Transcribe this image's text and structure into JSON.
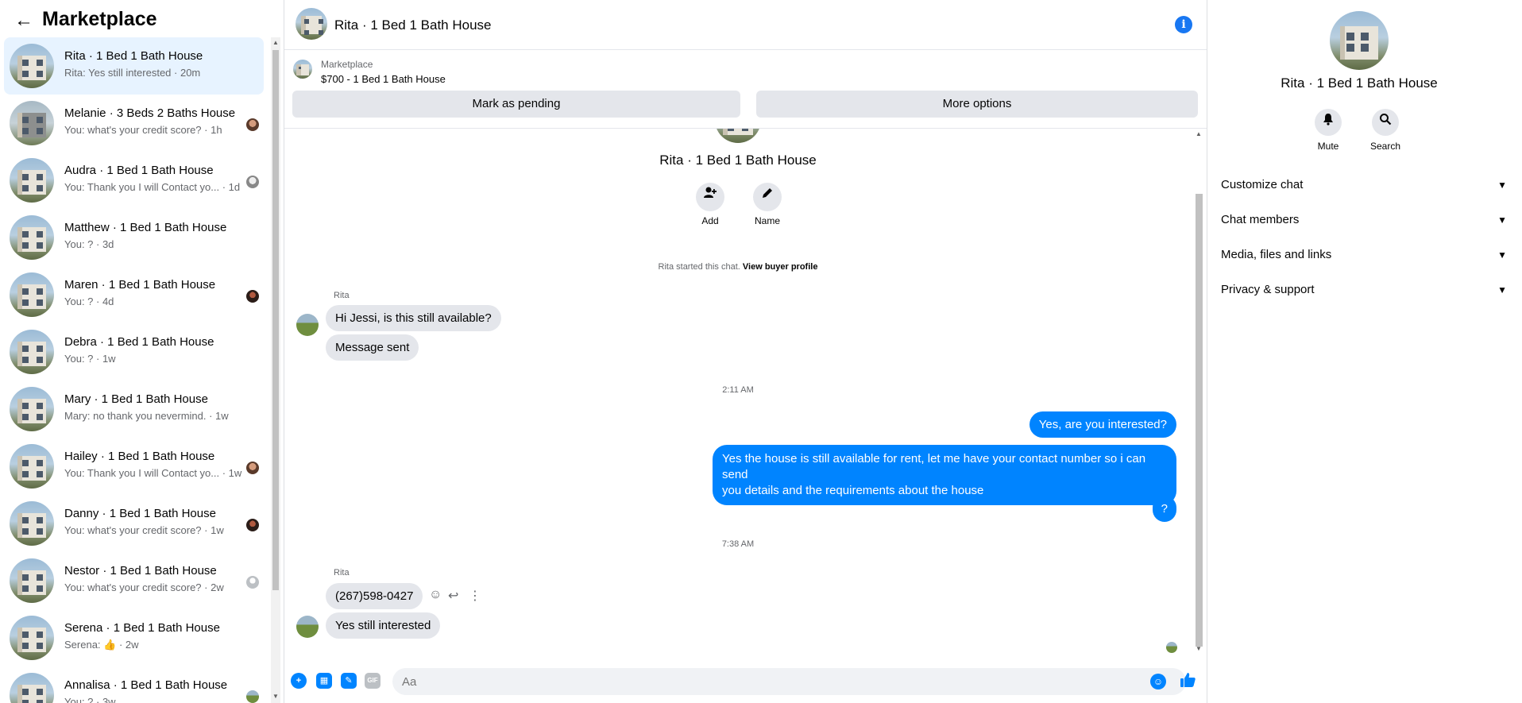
{
  "left": {
    "title": "Marketplace",
    "conversations": [
      {
        "name": "Rita · 1 Bed 1 Bath House",
        "preview": "Rita: Yes still interested · 20m",
        "active": true
      },
      {
        "name": "Melanie · 3 Beds 2 Baths House",
        "preview": "You: what's your credit score? · 1h"
      },
      {
        "name": "Audra · 1 Bed 1 Bath House",
        "preview": "You: Thank you I will Contact yo... · 1d"
      },
      {
        "name": "Matthew · 1 Bed 1 Bath House",
        "preview": "You: ? · 3d"
      },
      {
        "name": "Maren · 1 Bed 1 Bath House",
        "preview": "You: ? · 4d"
      },
      {
        "name": "Debra · 1 Bed 1 Bath House",
        "preview": "You: ? · 1w"
      },
      {
        "name": "Mary · 1 Bed 1 Bath House",
        "preview": "Mary: no thank you nevermind. · 1w"
      },
      {
        "name": "Hailey · 1 Bed 1 Bath House",
        "preview": "You: Thank you I will Contact yo... · 1w"
      },
      {
        "name": "Danny · 1 Bed 1 Bath House",
        "preview": "You: what's your credit score? · 1w"
      },
      {
        "name": "Nestor · 1 Bed 1 Bath House",
        "preview": "You: what's your credit score? · 2w"
      },
      {
        "name": "Serena · 1 Bed 1 Bath House",
        "preview": "Serena: 👍 · 2w"
      },
      {
        "name": "Annalisa · 1 Bed 1 Bath House",
        "preview": "You: ? · 3w"
      }
    ]
  },
  "chat": {
    "title": "Rita · 1 Bed 1 Bath House",
    "info_icon": "info-icon",
    "listing": {
      "source": "Marketplace",
      "title": "$700 - 1 Bed 1 Bath House",
      "btn_pending": "Mark as pending",
      "btn_more": "More options"
    },
    "thread_name": "Rita · 1 Bed 1 Bath House",
    "add_label": "Add",
    "name_label": "Name",
    "started_text": "Rita started this chat.",
    "view_profile": "View buyer profile",
    "sender1": "Rita",
    "msg1": "Hi Jessi, is this still available?",
    "msg2": "Message sent",
    "time1": "2:11 AM",
    "out1": "Yes, are you interested?",
    "out2_line1": "Yes the house is still available for rent, let me have your contact number so i can send",
    "out2_line2": "you details and the requirements about the house",
    "out3": "?",
    "time2": "7:38 AM",
    "sender2": "Rita",
    "msg3": "(267)598-0427",
    "msg4": "Yes still interested",
    "composer_placeholder": "Aa",
    "composer_icons": [
      "plus-icon",
      "photo-icon",
      "sticker-icon",
      "gif-icon"
    ],
    "gif_label": "GIF"
  },
  "right": {
    "title": "Rita · 1 Bed 1 Bath House",
    "mute_label": "Mute",
    "search_label": "Search",
    "sections": [
      "Customize chat",
      "Chat members",
      "Media, files and links",
      "Privacy & support"
    ]
  },
  "colors": {
    "accent": "#0084ff",
    "active_bg": "#e7f3ff",
    "bubble_in": "#e4e6eb"
  }
}
